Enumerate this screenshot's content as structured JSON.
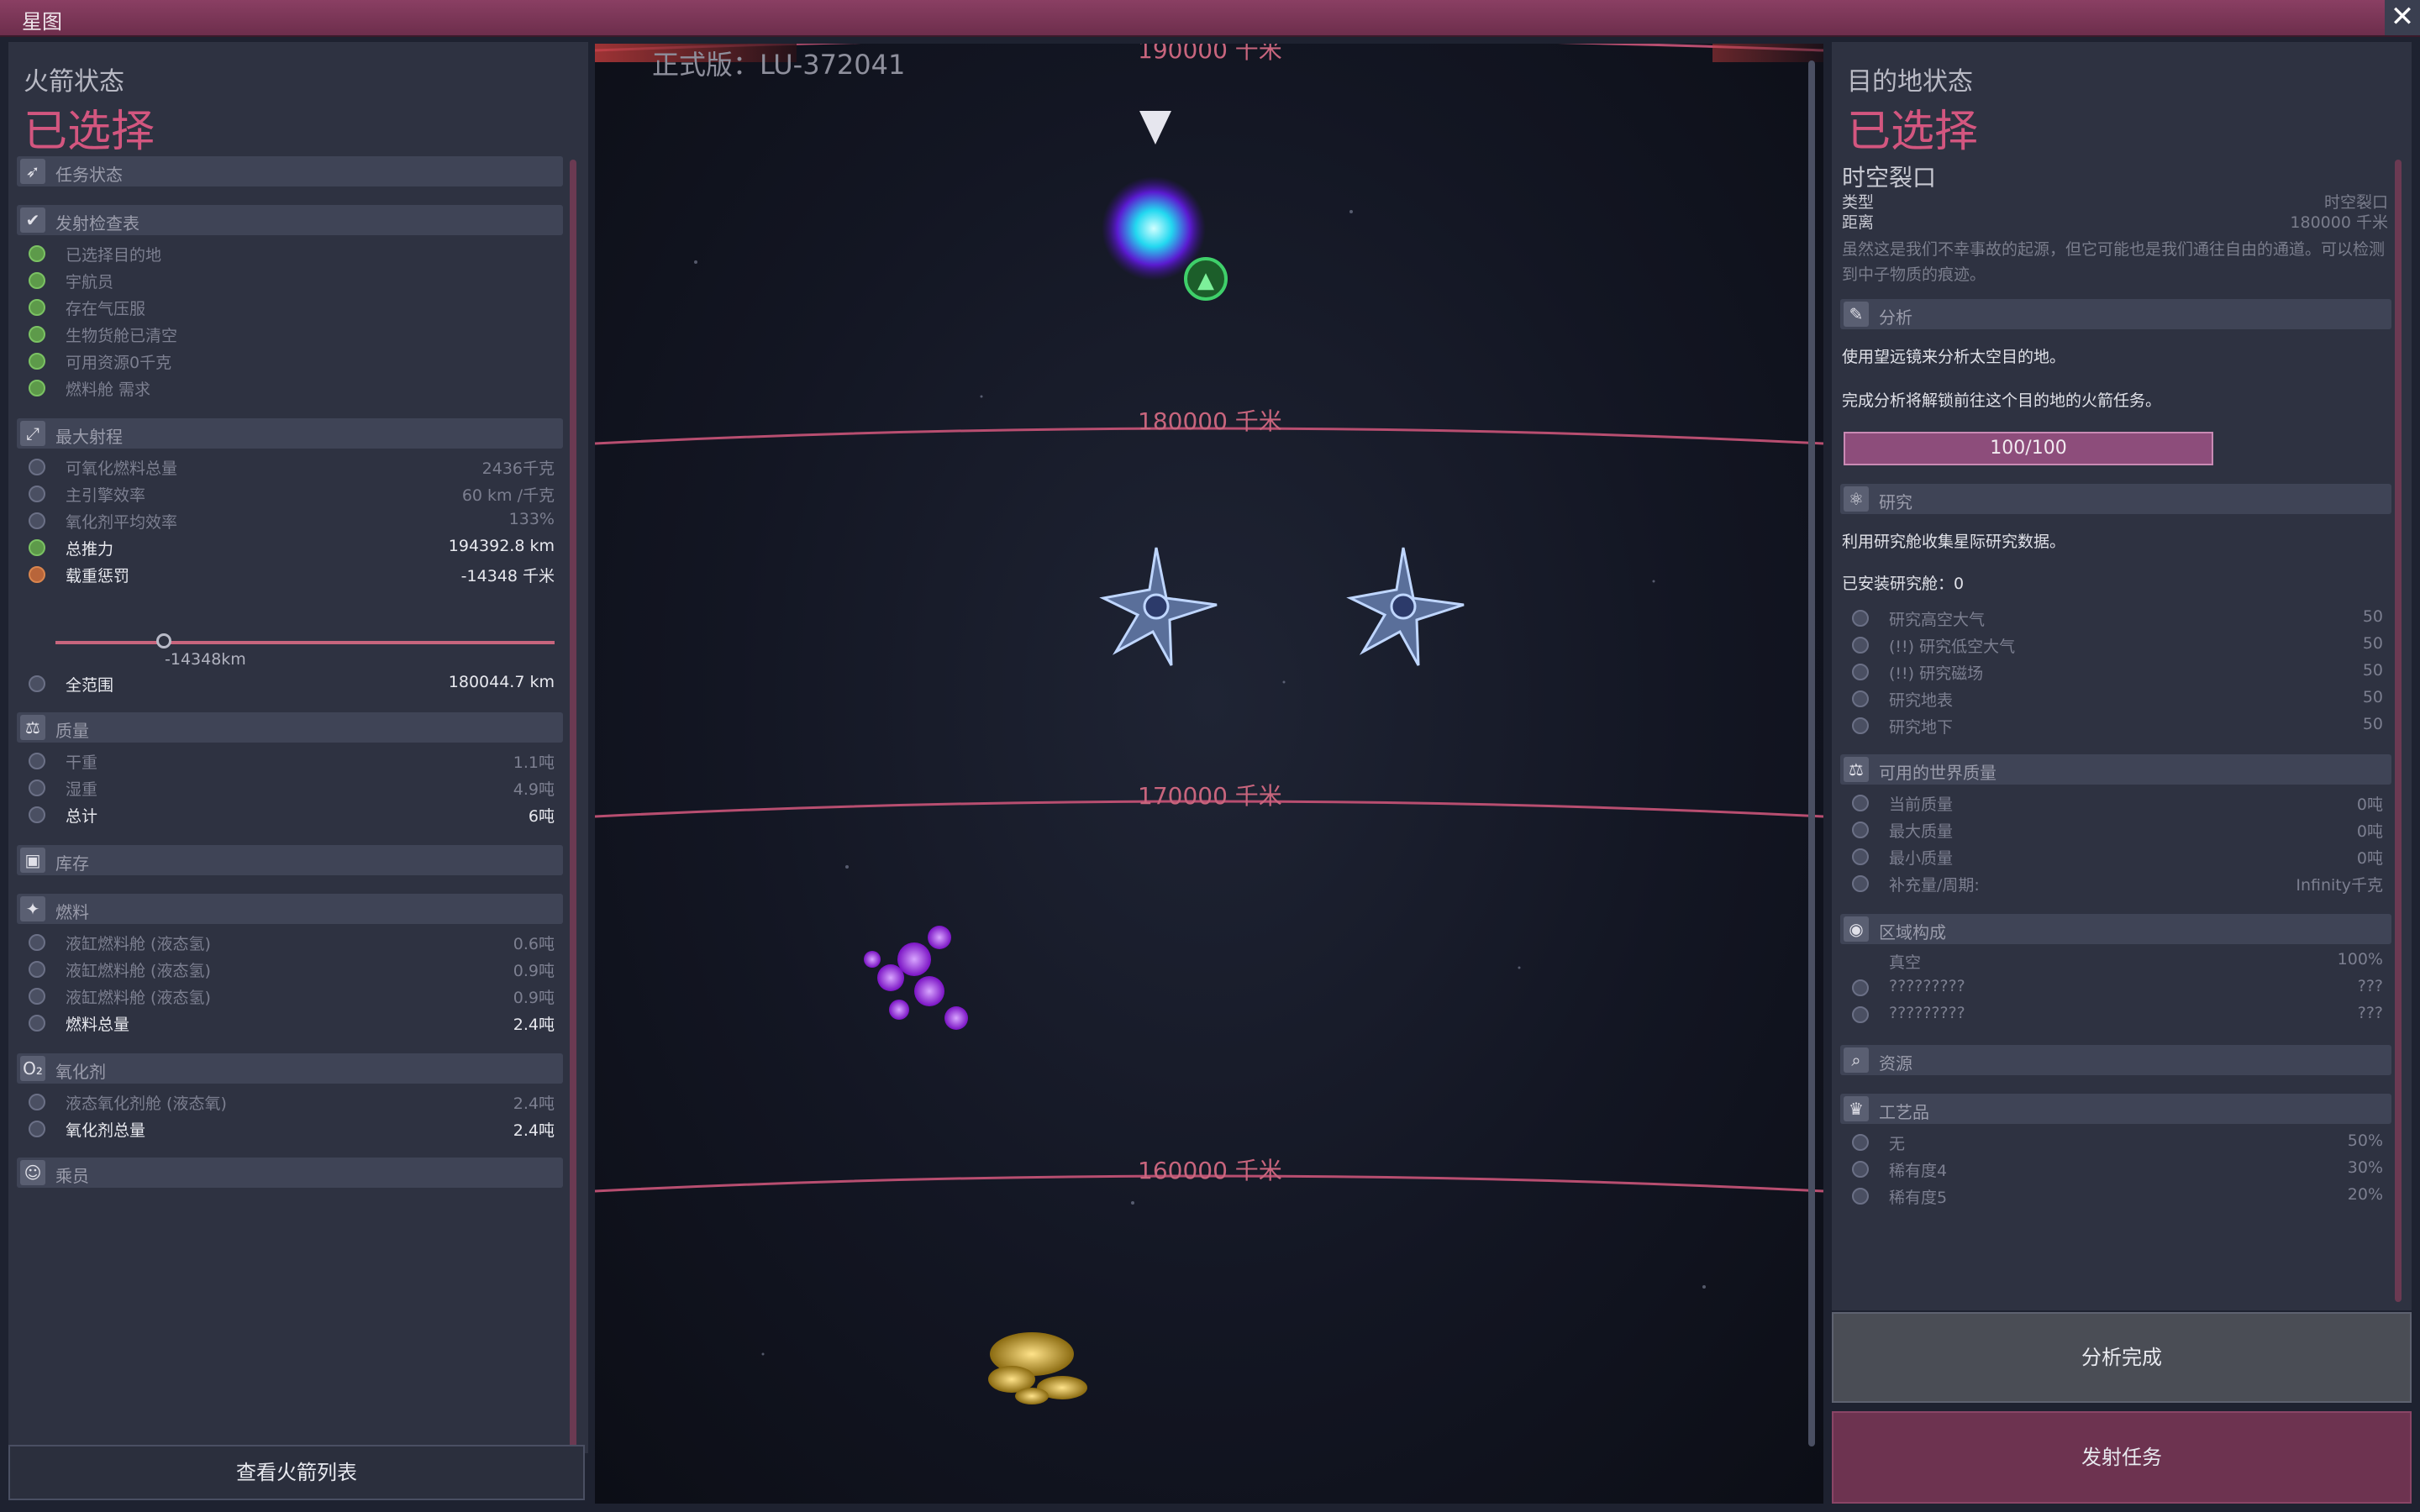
{
  "window": {
    "title": "星图",
    "close_icon": "close-icon"
  },
  "left": {
    "header": "火箭状态",
    "status": "已选择",
    "sections": {
      "mission": "任务状态",
      "checklist": "发射检查表",
      "range": "最大射程",
      "mass": "质量",
      "storage": "库存",
      "fuel": "燃料",
      "oxidizer": "氧化剂",
      "crew": "乘员"
    },
    "checklist_items": [
      "已选择目的地",
      "宇航员",
      "存在气压服",
      "生物货舱已清空",
      "可用资源0千克",
      "燃料舱 需求"
    ],
    "range_rows": [
      {
        "label": "可氧化燃料总量",
        "value": "2436千克"
      },
      {
        "label": "主引擎效率",
        "value": "60 km /千克"
      },
      {
        "label": "氧化剂平均效率",
        "value": "133%"
      },
      {
        "label": "总推力",
        "value": "194392.8 km"
      },
      {
        "label": "载重惩罚",
        "value": "-14348 千米"
      }
    ],
    "slider_value": "-14348km",
    "total_range": {
      "label": "全范围",
      "value": "180044.7 km"
    },
    "mass_rows": [
      {
        "label": "干重",
        "value": "1.1吨"
      },
      {
        "label": "湿重",
        "value": "4.9吨"
      },
      {
        "label": "总计",
        "value": "6吨"
      }
    ],
    "fuel_rows": [
      {
        "label": "液缸燃料舱 (液态氢)",
        "value": "0.6吨"
      },
      {
        "label": "液缸燃料舱 (液态氢)",
        "value": "0.9吨"
      },
      {
        "label": "液缸燃料舱 (液态氢)",
        "value": "0.9吨"
      },
      {
        "label": "燃料总量",
        "value": "2.4吨"
      }
    ],
    "oxidizer_rows": [
      {
        "label": "液态氧化剂舱 (液态氧)",
        "value": "2.4吨"
      },
      {
        "label": "氧化剂总量",
        "value": "2.4吨"
      }
    ],
    "view_list_button": "查看火箭列表"
  },
  "map": {
    "version": "正式版：LU-372041",
    "distances": [
      "190000 千米",
      "180000 千米",
      "170000 千米",
      "160000 千米"
    ],
    "colors": {
      "accent": "#d3567f",
      "line": "#b84e70",
      "panel": "#2e3241"
    }
  },
  "right": {
    "header": "目的地状态",
    "status": "已选择",
    "dest_name": "时空裂口",
    "type_label": "类型",
    "type_value": "时空裂口",
    "dist_label": "距离",
    "dist_value": "180000 千米",
    "description": "虽然这是我们不幸事故的起源，但它可能也是我们通往自由的通道。可以检测到中子物质的痕迹。",
    "analysis": {
      "title": "分析",
      "text1": "使用望远镜来分析太空目的地。",
      "text2": "完成分析将解锁前往这个目的地的火箭任务。",
      "progress_text": "100/100",
      "progress": 1.0
    },
    "research": {
      "title": "研究",
      "text": "利用研究舱收集星际研究数据。",
      "installed": "已安装研究舱：0",
      "items": [
        {
          "label": "研究高空大气",
          "value": "50"
        },
        {
          "label": "(!!) 研究低空大气",
          "value": "50"
        },
        {
          "label": "(!!) 研究磁场",
          "value": "50"
        },
        {
          "label": "研究地表",
          "value": "50"
        },
        {
          "label": "研究地下",
          "value": "50"
        }
      ]
    },
    "world_mass": {
      "title": "可用的世界质量",
      "items": [
        {
          "label": "当前质量",
          "value": "0吨"
        },
        {
          "label": "最大质量",
          "value": "0吨"
        },
        {
          "label": "最小质量",
          "value": "0吨"
        },
        {
          "label": "补充量/周期:",
          "value": "Infinity千克"
        }
      ]
    },
    "composition": {
      "title": "区域构成",
      "items": [
        {
          "label": "真空",
          "value": "100%"
        },
        {
          "label": "?????????",
          "value": "???"
        },
        {
          "label": "?????????",
          "value": "???"
        }
      ]
    },
    "resources": {
      "title": "资源"
    },
    "artifacts": {
      "title": "工艺品",
      "items": [
        {
          "label": "无",
          "value": "50%"
        },
        {
          "label": "稀有度4",
          "value": "30%"
        },
        {
          "label": "稀有度5",
          "value": "20%"
        }
      ]
    },
    "analysis_done_button": "分析完成",
    "launch_button": "发射任务"
  }
}
